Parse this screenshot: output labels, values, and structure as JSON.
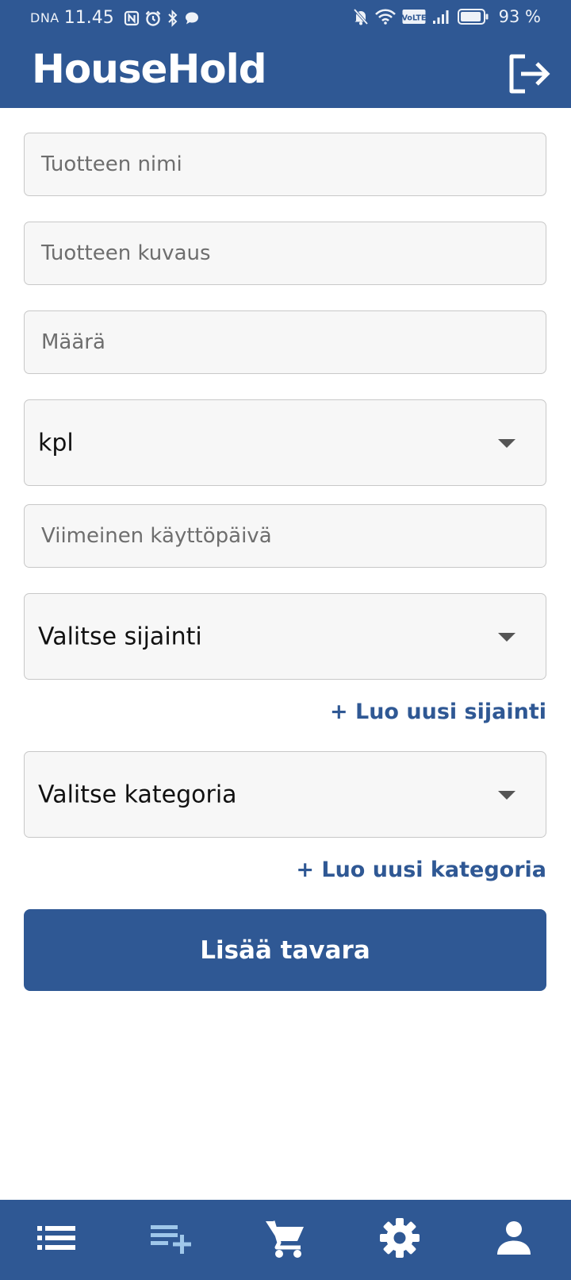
{
  "status_bar": {
    "carrier": "DNA",
    "time": "11.45",
    "volte": "VoLTE",
    "battery_percent": "93 %",
    "battery_level": 0.93,
    "icons": [
      "nfc-icon",
      "alarm-icon",
      "bluetooth-icon",
      "chat-bubble-icon",
      "notifications-off-icon",
      "wifi-icon",
      "volte-icon",
      "signal-icon",
      "battery-icon"
    ]
  },
  "app_bar": {
    "title": "HouseHold",
    "logout_icon": "logout-icon"
  },
  "form": {
    "name_placeholder": "Tuotteen nimi",
    "description_placeholder": "Tuotteen kuvaus",
    "quantity_placeholder": "Määrä",
    "unit_selected": "kpl",
    "expiry_placeholder": "Viimeinen käyttöpäivä",
    "location_selected": "Valitse sijainti",
    "new_location_link": "+ Luo uusi sijainti",
    "category_selected": "Valitse kategoria",
    "new_category_link": "+ Luo uusi kategoria",
    "submit_label": "Lisää tavara"
  },
  "bottom_nav": {
    "items": [
      {
        "icon": "list-icon",
        "active": false
      },
      {
        "icon": "playlist-add-icon",
        "active": true
      },
      {
        "icon": "cart-icon",
        "active": false
      },
      {
        "icon": "settings-icon",
        "active": false
      },
      {
        "icon": "person-icon",
        "active": false
      }
    ]
  },
  "colors": {
    "primary": "#2f5894",
    "nav_active_icon": "#9fc7ea",
    "field_background": "#f7f7f7",
    "field_border": "#c8c8c8",
    "placeholder_text": "#6e6e6e"
  }
}
